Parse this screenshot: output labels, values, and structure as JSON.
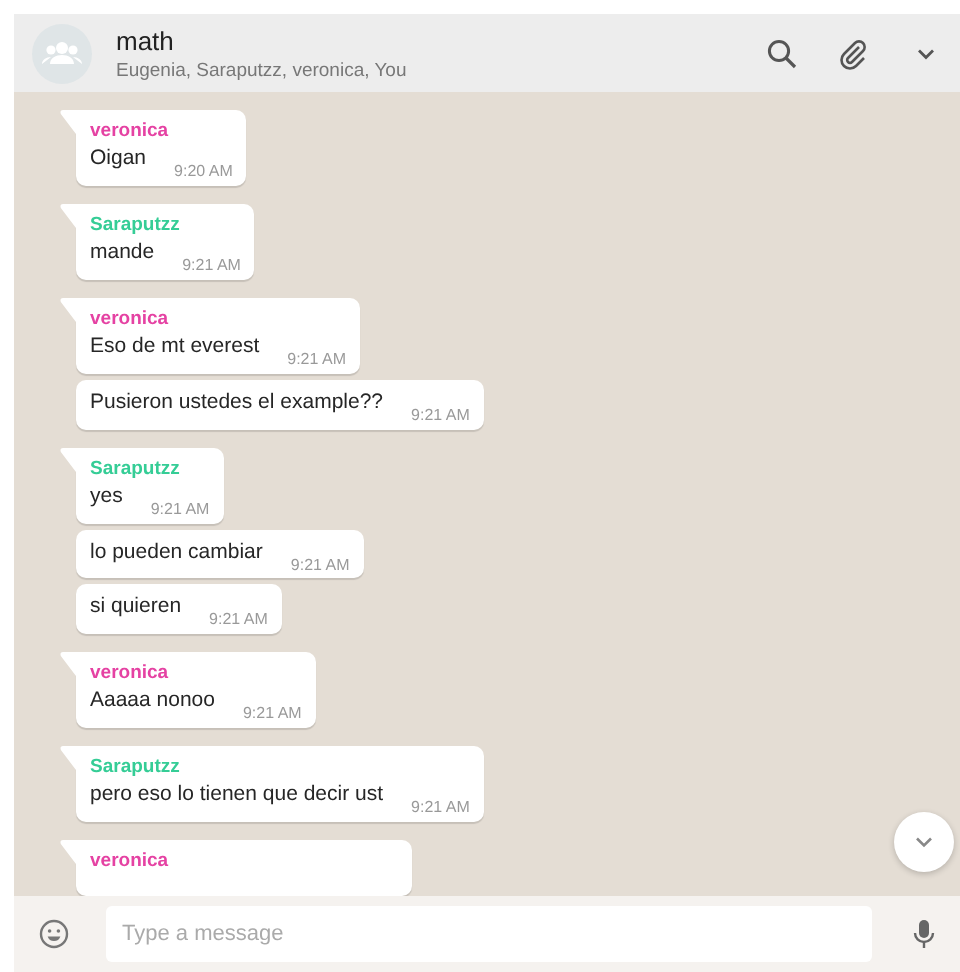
{
  "header": {
    "title": "math",
    "participants": "Eugenia, Saraputzz, veronica, You"
  },
  "messages": [
    {
      "sender": "veronica",
      "color": "#e542a3",
      "text": "Oigan",
      "time": "9:20 AM"
    },
    {
      "sender": "Saraputzz",
      "color": "#35cd96",
      "text": "mande",
      "time": "9:21 AM"
    },
    {
      "sender": "veronica",
      "color": "#e542a3",
      "text": "Eso de mt everest",
      "time": "9:21 AM"
    },
    {
      "text": "Pusieron ustedes el example??",
      "time": "9:21 AM"
    },
    {
      "sender": "Saraputzz",
      "color": "#35cd96",
      "text": "yes",
      "time": "9:21 AM"
    },
    {
      "text": "lo pueden cambiar",
      "time": "9:21 AM"
    },
    {
      "text": "si quieren",
      "time": "9:21 AM"
    },
    {
      "sender": "veronica",
      "color": "#e542a3",
      "text": "Aaaaa nonoo",
      "time": "9:21 AM"
    },
    {
      "sender": "Saraputzz",
      "color": "#35cd96",
      "text": "pero eso lo tienen que decir ust",
      "time": "9:21 AM"
    },
    {
      "sender": "veronica",
      "color": "#e542a3"
    }
  ],
  "composer": {
    "placeholder": "Type a message"
  }
}
